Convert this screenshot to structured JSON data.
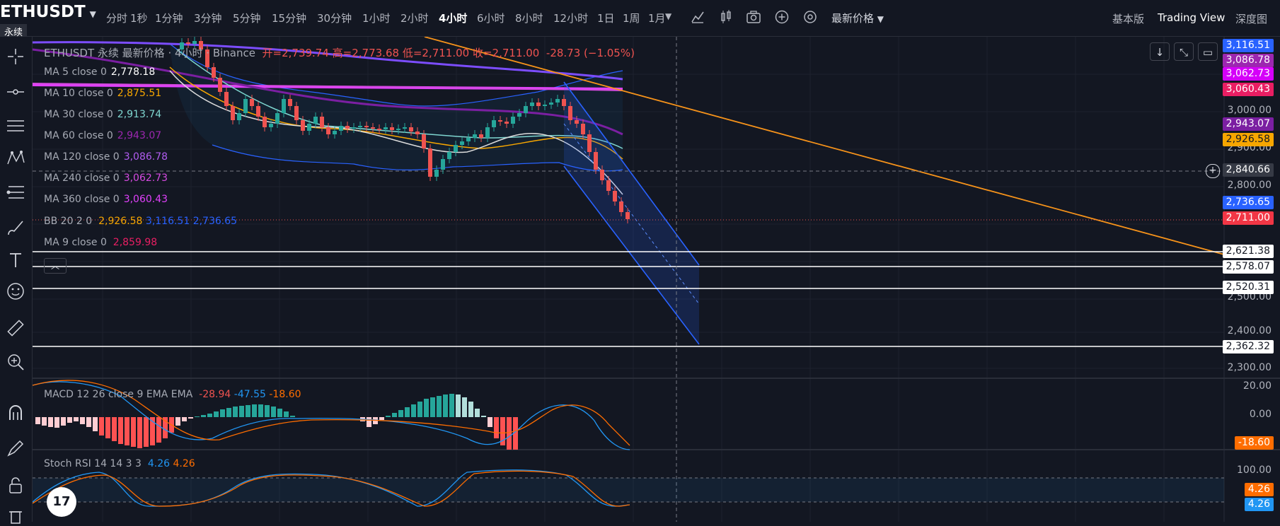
{
  "symbol": "ETHUSDT",
  "contract_badge": "永续",
  "intervals": [
    "分时",
    "1秒",
    "1分钟",
    "3分钟",
    "5分钟",
    "15分钟",
    "30分钟",
    "1小时",
    "2小时",
    "4小时",
    "6小时",
    "8小时",
    "12小时",
    "1日",
    "1周",
    "1月"
  ],
  "active_interval": "4小时",
  "price_type": "最新价格",
  "view_modes": {
    "basic": "基本版",
    "tradingview": "Trading View",
    "depth": "深度图"
  },
  "headline": {
    "title": "ETHUSDT 永续 最新价格 · 4小时 · Binance",
    "open": "开=2,739.74",
    "high": "高=2,773.68",
    "low": "低=2,711.00",
    "close": "收=2,711.00",
    "change": "-28.73 (−1.05%)"
  },
  "ma_legend": [
    {
      "label": "MA 5 close 0",
      "value": "2,778.18",
      "color": "#ffffff"
    },
    {
      "label": "MA 10 close 0",
      "value": "2,875.51",
      "color": "#f7a600"
    },
    {
      "label": "MA 30 close 0",
      "value": "2,913.74",
      "color": "#7fd6d0"
    },
    {
      "label": "MA 60 close 0",
      "value": "2,943.07",
      "color": "#9c27b0"
    },
    {
      "label": "MA 120 close 0",
      "value": "3,086.78",
      "color": "#b15cf0"
    },
    {
      "label": "MA 240 close 0",
      "value": "3,062.73",
      "color": "#d54ae0"
    },
    {
      "label": "MA 360 close 0",
      "value": "3,060.43",
      "color": "#e040fb"
    }
  ],
  "bb_legend": {
    "label": "BB 20 2 0",
    "basis": "2,926.58",
    "upper": "3,116.51",
    "lower": "2,736.65"
  },
  "ma9_legend": {
    "label": "MA 9 close 0",
    "value": "2,859.98"
  },
  "macd_legend": {
    "label": "MACD 12 26 close 9 EMA EMA",
    "hist": "-28.94",
    "macd": "-47.55",
    "signal": "-18.60"
  },
  "stoch_legend": {
    "label": "Stoch RSI 14 14 3 3",
    "k": "4.26",
    "d": "4.26"
  },
  "price_axis_ticks": [
    "3,000.00",
    "2,900.00",
    "2,800.00",
    "2,500.00",
    "2,400.00",
    "2,300.00"
  ],
  "price_labels": [
    {
      "value": "3,116.51",
      "bg": "#2962ff",
      "fg": "#ffffff"
    },
    {
      "value": "3,086.78",
      "bg": "#9c27b0",
      "fg": "#ffffff"
    },
    {
      "value": "3,062.73",
      "bg": "#d500f9",
      "fg": "#ffffff"
    },
    {
      "value": "3,060.43",
      "bg": "#e91e63",
      "fg": "#ffffff"
    },
    {
      "value": "2,943.07",
      "bg": "#7b1fa2",
      "fg": "#ffffff"
    },
    {
      "value": "2,926.58",
      "bg": "#f7a600",
      "fg": "#131722"
    },
    {
      "value": "2,840.66",
      "bg": "#363a45",
      "fg": "#ffffff"
    },
    {
      "value": "2,736.65",
      "bg": "#2962ff",
      "fg": "#ffffff"
    },
    {
      "value": "2,711.00",
      "bg": "#f23645",
      "fg": "#ffffff"
    },
    {
      "value": "2,621.38",
      "bg": "#ffffff",
      "fg": "#131722"
    },
    {
      "value": "2,578.07",
      "bg": "#ffffff",
      "fg": "#131722"
    },
    {
      "value": "2,520.31",
      "bg": "#ffffff",
      "fg": "#131722"
    },
    {
      "value": "2,362.32",
      "bg": "#ffffff",
      "fg": "#131722"
    }
  ],
  "macd_axis_ticks": [
    "20.00",
    "0.00"
  ],
  "macd_label": {
    "value": "-18.60",
    "bg": "#ff6d00",
    "fg": "#ffffff"
  },
  "stoch_axis_ticks": [
    "100.00"
  ],
  "stoch_labels": [
    {
      "value": "4.26",
      "bg": "#ff6d00",
      "fg": "#ffffff"
    },
    {
      "value": "4.26",
      "bg": "#2196f3",
      "fg": "#ffffff"
    }
  ],
  "logo_text": "17",
  "colors": {
    "up": "#26a69a",
    "down": "#ef5350",
    "background": "#131722",
    "grid": "#1e222d"
  }
}
